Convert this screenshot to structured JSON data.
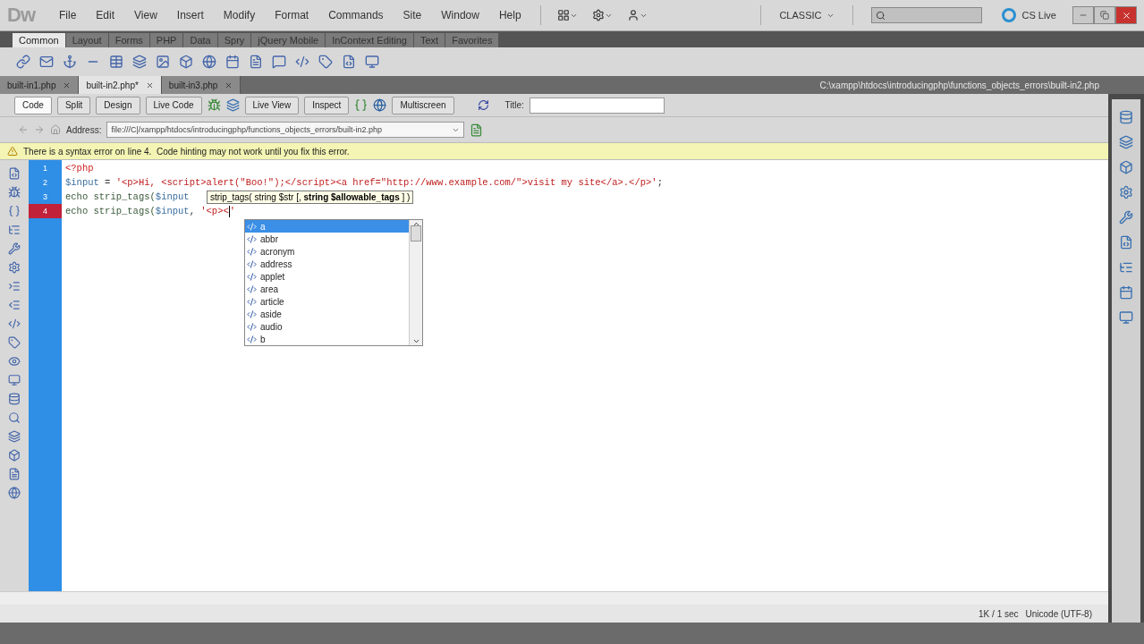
{
  "app": {
    "logo": "Dw",
    "menus": [
      "File",
      "Edit",
      "View",
      "Insert",
      "Modify",
      "Format",
      "Commands",
      "Site",
      "Window",
      "Help"
    ],
    "workspace": "CLASSIC",
    "cs_live": "CS Live"
  },
  "insert_tabs": [
    {
      "label": "Common",
      "selected": true
    },
    {
      "label": "Layout",
      "selected": false
    },
    {
      "label": "Forms",
      "selected": false
    },
    {
      "label": "PHP",
      "selected": false
    },
    {
      "label": "Data",
      "selected": false
    },
    {
      "label": "Spry",
      "selected": false
    },
    {
      "label": "jQuery Mobile",
      "selected": false
    },
    {
      "label": "InContext Editing",
      "selected": false
    },
    {
      "label": "Text",
      "selected": false
    },
    {
      "label": "Favorites",
      "selected": false
    }
  ],
  "document_tabs": [
    {
      "label": "built-in1.php",
      "selected": false
    },
    {
      "label": "built-in2.php*",
      "selected": true
    },
    {
      "label": "built-in3.php",
      "selected": false
    }
  ],
  "document_path": "C:\\xampp\\htdocs\\introducingphp\\functions_objects_errors\\built-in2.php",
  "view_buttons": [
    {
      "label": "Code",
      "selected": true
    },
    {
      "label": "Split",
      "selected": false
    },
    {
      "label": "Design",
      "selected": false
    }
  ],
  "document_toolbar": {
    "live_code": "Live Code",
    "live_view": "Live View",
    "inspect": "Inspect",
    "multiscreen": "Multiscreen",
    "title_label": "Title:"
  },
  "address": {
    "label": "Address:",
    "value": "file:///C|/xampp/htdocs/introducingphp/functions_objects_errors/built-in2.php"
  },
  "warning": "There is a syntax error on line 4.  Code hinting may not work until you fix this error.",
  "code_lines": [
    {
      "number": "1",
      "error": false,
      "segments": [
        {
          "kind": "delim",
          "text": "<?php"
        }
      ]
    },
    {
      "number": "2",
      "error": false,
      "segments": [
        {
          "kind": "var",
          "text": "$input"
        },
        {
          "kind": "op",
          "text": " = "
        },
        {
          "kind": "string",
          "text": "'<p>Hi, <script>alert(\"Boo!\");</script><a href=\"http://www.example.com/\">visit my site</a>.</p>'"
        },
        {
          "kind": "op",
          "text": ";"
        }
      ]
    },
    {
      "number": "3",
      "error": false,
      "segments": [
        {
          "kind": "keyword",
          "text": "echo strip_tags("
        },
        {
          "kind": "var",
          "text": "$input"
        }
      ]
    },
    {
      "number": "4",
      "error": true,
      "segments": [
        {
          "kind": "keyword",
          "text": "echo strip_tags("
        },
        {
          "kind": "var",
          "text": "$input"
        },
        {
          "kind": "op",
          "text": ", "
        },
        {
          "kind": "string",
          "text": "'<p><"
        },
        {
          "kind": "cursor"
        },
        {
          "kind": "string",
          "text": "'"
        }
      ]
    }
  ],
  "code_hint": "strip_tags( string $str [, **string $allowable_tags** ] )",
  "completions": [
    {
      "label": "a",
      "selected": true
    },
    {
      "label": "abbr",
      "selected": false
    },
    {
      "label": "acronym",
      "selected": false
    },
    {
      "label": "address",
      "selected": false
    },
    {
      "label": "applet",
      "selected": false
    },
    {
      "label": "area",
      "selected": false
    },
    {
      "label": "article",
      "selected": false
    },
    {
      "label": "aside",
      "selected": false
    },
    {
      "label": "audio",
      "selected": false
    },
    {
      "label": "b",
      "selected": false
    }
  ],
  "status_bar": {
    "size": "1K / 1 sec",
    "encoding": "Unicode (UTF-8)"
  }
}
